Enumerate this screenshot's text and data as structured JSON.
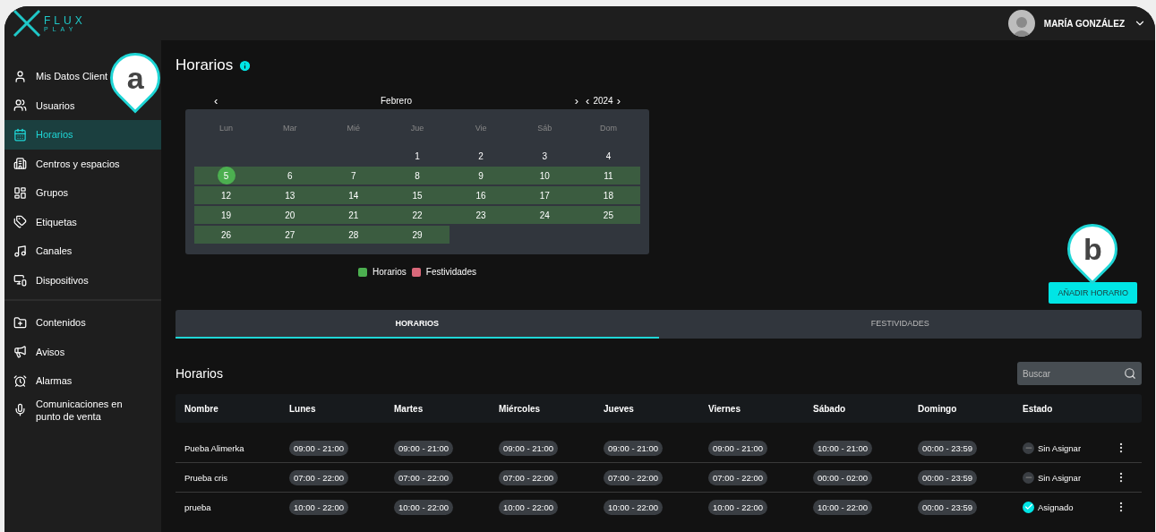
{
  "logo": {
    "word": "FLUX",
    "subword": "PLAY"
  },
  "user": {
    "name": "MARÍA GONZÁLEZ"
  },
  "sidebar": {
    "groups": [
      {
        "items": [
          {
            "label": "Mis Datos Client",
            "selected": false
          },
          {
            "label": "Usuarios",
            "selected": false
          },
          {
            "label": "Horarios",
            "selected": true
          },
          {
            "label": "Centros y espacios",
            "selected": false
          },
          {
            "label": "Grupos",
            "selected": false
          },
          {
            "label": "Etiquetas",
            "selected": false
          },
          {
            "label": "Canales",
            "selected": false
          },
          {
            "label": "Dispositivos",
            "selected": false
          }
        ]
      },
      {
        "items": [
          {
            "label": "Contenidos",
            "selected": false
          },
          {
            "label": "Avisos",
            "selected": false
          },
          {
            "label": "Alarmas",
            "selected": false
          },
          {
            "label": "Comunicaciones en punto de venta",
            "selected": false
          }
        ]
      }
    ]
  },
  "callouts": [
    {
      "letter": "a",
      "kind": "sidebar"
    },
    {
      "letter": "b",
      "kind": "button"
    }
  ],
  "page_title": "Horarios",
  "calendar": {
    "prev": "‹",
    "month": "Febrero",
    "next": "›",
    "year_prev": "‹",
    "year": "2024",
    "year_next": "›",
    "weekdays": [
      "Lun",
      "Mar",
      "Mié",
      "Jue",
      "Vie",
      "Sáb",
      "Dom"
    ],
    "weeks": [
      [
        {
          "kind": "empty"
        },
        {
          "kind": "empty"
        },
        {
          "kind": "empty"
        },
        {
          "kind": "day",
          "day": "1",
          "scheduled": false,
          "today": false
        },
        {
          "kind": "day",
          "day": "2",
          "scheduled": false,
          "today": false
        },
        {
          "kind": "day",
          "day": "3",
          "scheduled": false,
          "today": false
        },
        {
          "kind": "day",
          "day": "4",
          "scheduled": false,
          "today": false
        }
      ],
      [
        {
          "kind": "day",
          "day": "5",
          "scheduled": true,
          "today": true
        },
        {
          "kind": "day",
          "day": "6",
          "scheduled": true,
          "today": false
        },
        {
          "kind": "day",
          "day": "7",
          "scheduled": true,
          "today": false
        },
        {
          "kind": "day",
          "day": "8",
          "scheduled": true,
          "today": false
        },
        {
          "kind": "day",
          "day": "9",
          "scheduled": true,
          "today": false
        },
        {
          "kind": "day",
          "day": "10",
          "scheduled": true,
          "today": false
        },
        {
          "kind": "day",
          "day": "11",
          "scheduled": true,
          "today": false
        }
      ],
      [
        {
          "kind": "day",
          "day": "12",
          "scheduled": true,
          "today": false
        },
        {
          "kind": "day",
          "day": "13",
          "scheduled": true,
          "today": false
        },
        {
          "kind": "day",
          "day": "14",
          "scheduled": true,
          "today": false
        },
        {
          "kind": "day",
          "day": "15",
          "scheduled": true,
          "today": false
        },
        {
          "kind": "day",
          "day": "16",
          "scheduled": true,
          "today": false
        },
        {
          "kind": "day",
          "day": "17",
          "scheduled": true,
          "today": false
        },
        {
          "kind": "day",
          "day": "18",
          "scheduled": true,
          "today": false
        }
      ],
      [
        {
          "kind": "day",
          "day": "19",
          "scheduled": true,
          "today": false
        },
        {
          "kind": "day",
          "day": "20",
          "scheduled": true,
          "today": false
        },
        {
          "kind": "day",
          "day": "21",
          "scheduled": true,
          "today": false
        },
        {
          "kind": "day",
          "day": "22",
          "scheduled": true,
          "today": false
        },
        {
          "kind": "day",
          "day": "23",
          "scheduled": true,
          "today": false
        },
        {
          "kind": "day",
          "day": "24",
          "scheduled": true,
          "today": false
        },
        {
          "kind": "day",
          "day": "25",
          "scheduled": true,
          "today": false
        }
      ],
      [
        {
          "kind": "day",
          "day": "26",
          "scheduled": true,
          "today": false
        },
        {
          "kind": "day",
          "day": "27",
          "scheduled": true,
          "today": false
        },
        {
          "kind": "day",
          "day": "28",
          "scheduled": true,
          "today": false
        },
        {
          "kind": "day",
          "day": "29",
          "scheduled": true,
          "today": false
        }
      ]
    ],
    "legend": [
      {
        "label": "Horarios",
        "color": "#4caf50"
      },
      {
        "label": "Festividades",
        "color": "#d9687a"
      }
    ]
  },
  "add_button": "AÑADIR HORARIO",
  "tabs": [
    {
      "label": "HORARIOS",
      "selected": true
    },
    {
      "label": "FESTIVIDADES",
      "selected": false
    }
  ],
  "table": {
    "title": "Horarios",
    "search": {
      "placeholder": "Buscar"
    },
    "columns": [
      "Nombre",
      "Lunes",
      "Martes",
      "Miércoles",
      "Jueves",
      "Viernes",
      "Sábado",
      "Domingo",
      "Estado"
    ],
    "rows": [
      {
        "name": "Pueba Alimerka",
        "times": [
          "09:00 - 21:00",
          "09:00 - 21:00",
          "09:00 - 21:00",
          "09:00 - 21:00",
          "09:00 - 21:00",
          "10:00 - 21:00",
          "00:00 - 23:59"
        ],
        "status": "Sin Asignar",
        "assigned": false
      },
      {
        "name": "Prueba cris",
        "times": [
          "07:00 - 22:00",
          "07:00 - 22:00",
          "07:00 - 22:00",
          "07:00 - 22:00",
          "07:00 - 22:00",
          "00:00 - 02:00",
          "00:00 - 23:59"
        ],
        "status": "Sin Asignar",
        "assigned": false
      },
      {
        "name": "prueba",
        "times": [
          "10:00 - 22:00",
          "10:00 - 22:00",
          "10:00 - 22:00",
          "10:00 - 22:00",
          "10:00 - 22:00",
          "10:00 - 22:00",
          "00:00 - 23:59"
        ],
        "status": "Asignado",
        "assigned": true
      }
    ]
  }
}
